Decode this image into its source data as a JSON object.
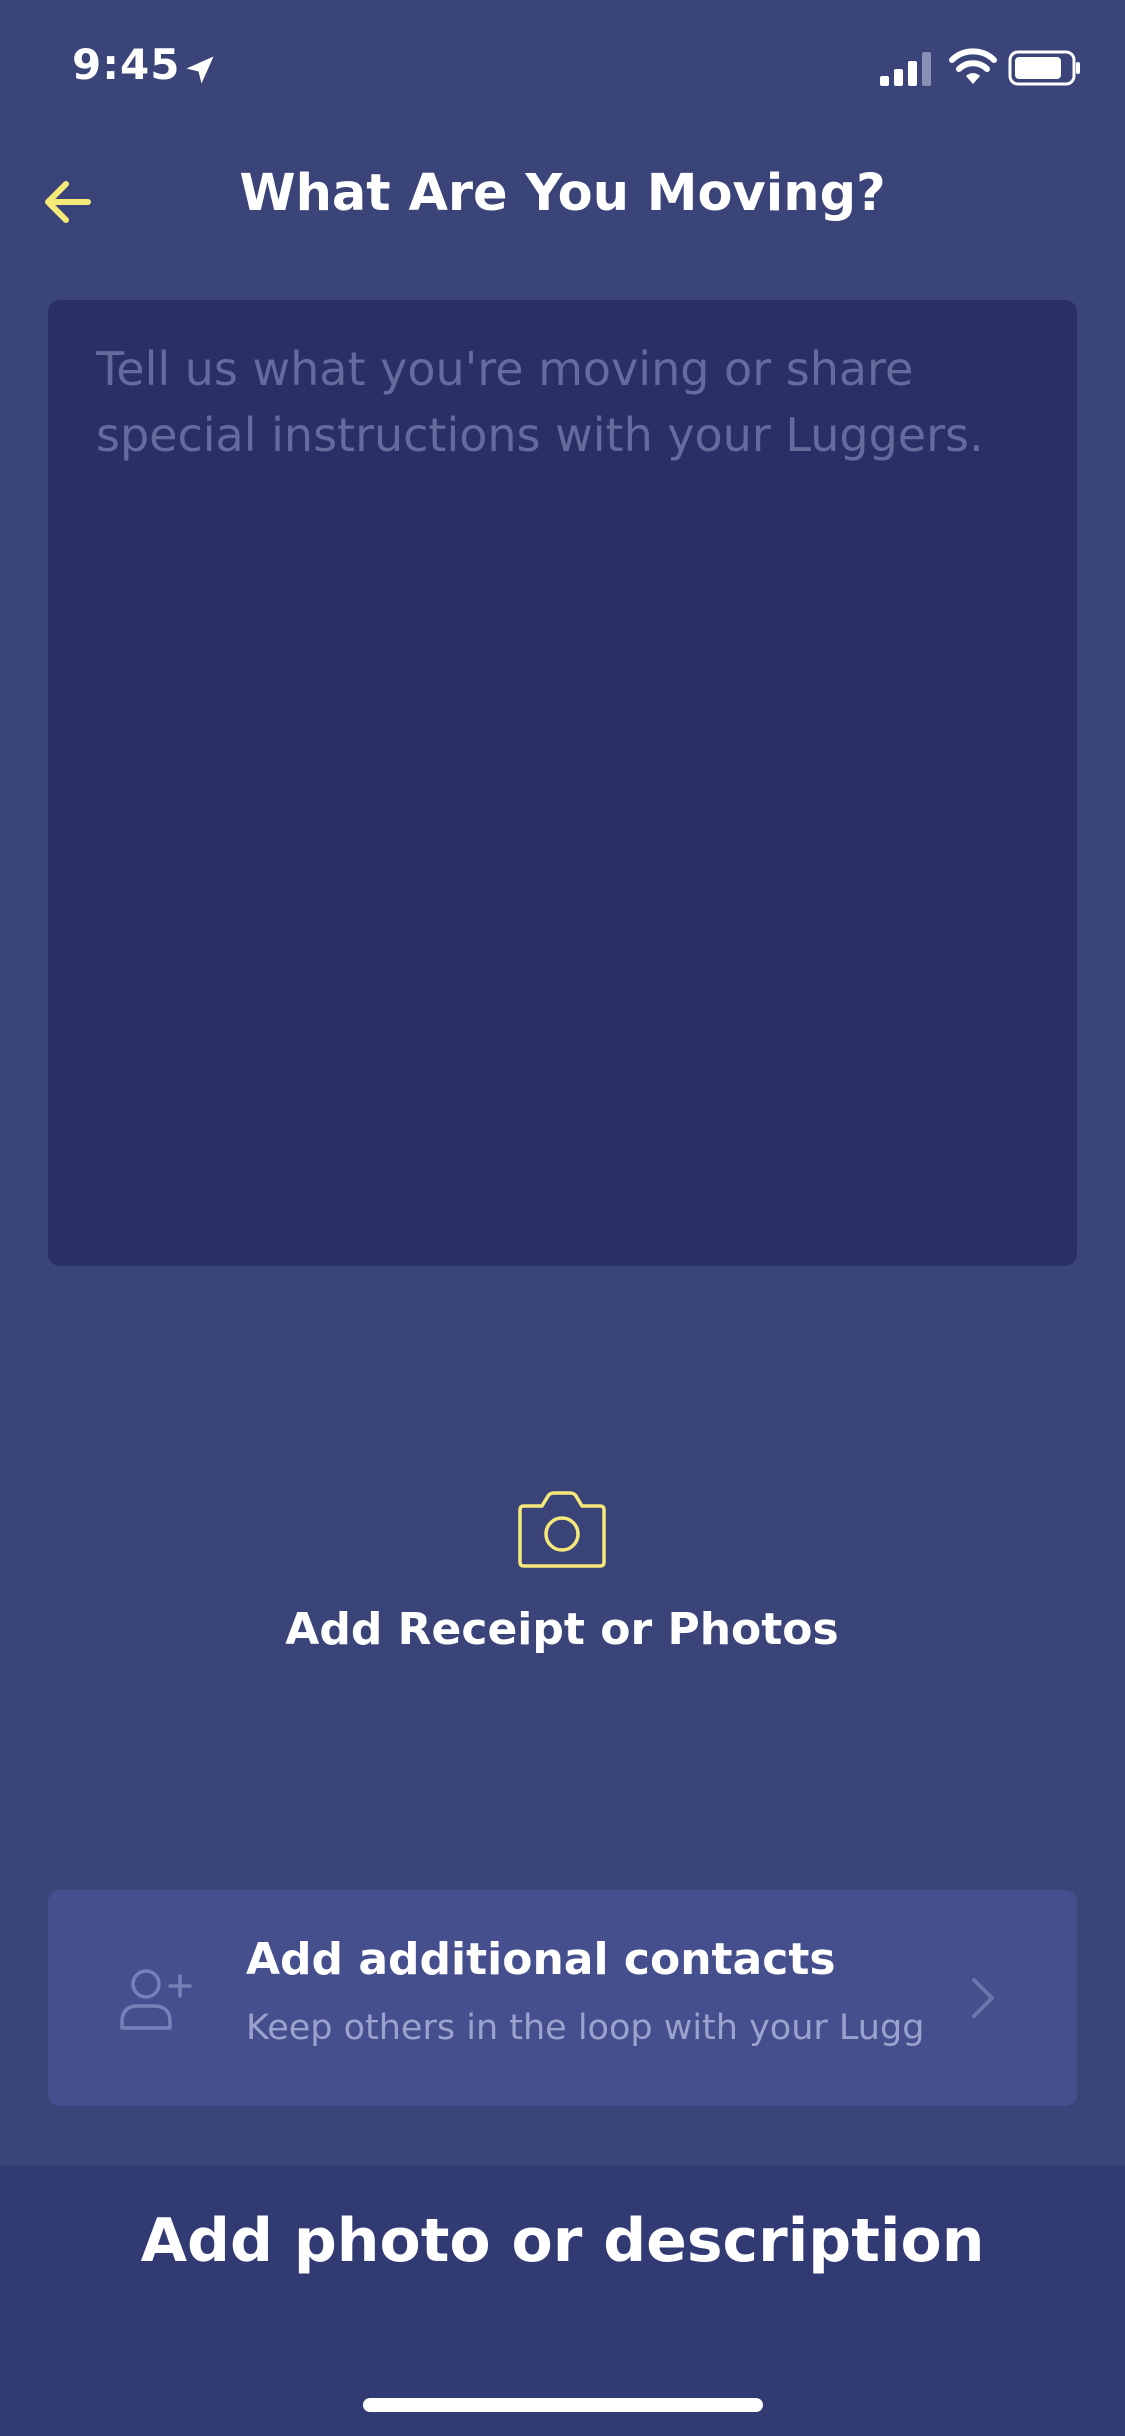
{
  "status_bar": {
    "time": "9:45",
    "icons": [
      "location-arrow-icon",
      "cellular-signal-icon",
      "wifi-icon",
      "battery-icon"
    ]
  },
  "header": {
    "title": "What Are You Moving?",
    "back_icon": "arrow-left-icon"
  },
  "description": {
    "placeholder": "Tell us what you're moving or share special instructions with your Luggers.",
    "value": ""
  },
  "photos": {
    "icon": "camera-icon",
    "label": "Add Receipt or Photos"
  },
  "contacts": {
    "icon": "person-add-icon",
    "title": "Add additional contacts",
    "subtitle": "Keep others in the loop with your Lugg",
    "chevron_icon": "chevron-right-icon"
  },
  "bottom_action": {
    "label": "Add photo or description"
  },
  "colors": {
    "background": "#3b4479",
    "input_background": "#283066",
    "card_background": "#454f8d",
    "bottom_bar": "#323a74",
    "accent_yellow": "#f5e97a",
    "placeholder": "#646c9c",
    "muted_text": "#9ba2cd"
  }
}
